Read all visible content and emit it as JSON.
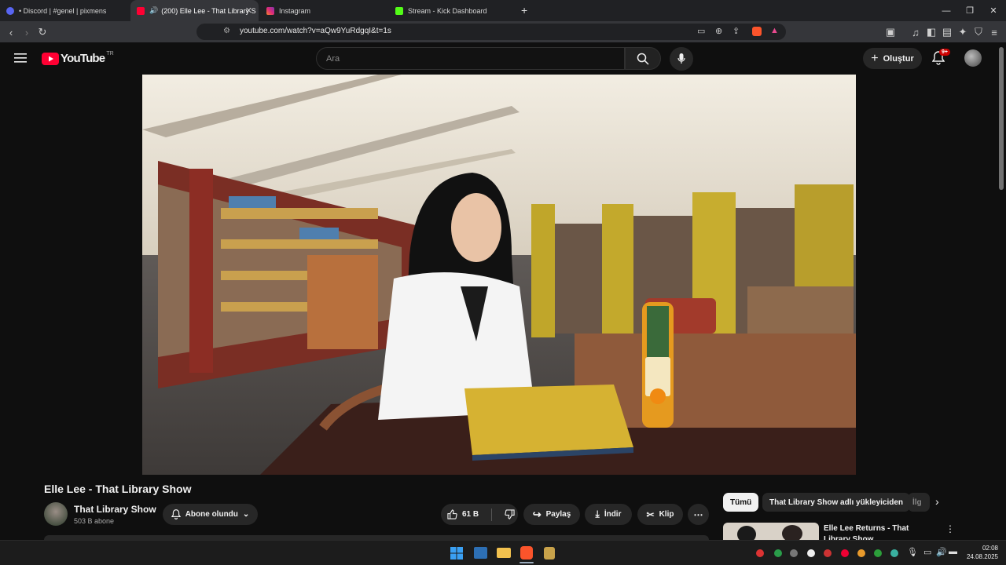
{
  "browser": {
    "tabs": [
      {
        "label": "• Discord | #genel | pixmens",
        "favicon_color": "#5865f2",
        "active": false
      },
      {
        "label": "(200) Elle Lee - That Library S",
        "favicon_color": "#ff0033",
        "active": true
      },
      {
        "label": "Instagram",
        "favicon_color": "#e1306c",
        "active": false
      },
      {
        "label": "Stream - Kick Dashboard",
        "favicon_color": "#53fc18",
        "active": false
      }
    ],
    "url": "youtube.com/watch?v=aQw9YuRdgqI&t=1s"
  },
  "youtube": {
    "logo_text": "YouTube",
    "region": "TR",
    "search_placeholder": "Ara",
    "create_label": "Oluştur",
    "notification_count": "9+",
    "video_title": "Elle Lee - That Library Show",
    "channel_name": "That Library Show",
    "subscriber_count": "503 B abone",
    "subscribe_label": "Abone olundu",
    "like_count": "61 B",
    "share_label": "Paylaş",
    "download_label": "İndir",
    "clip_label": "Klip",
    "chips": [
      "Tümü",
      "That Library Show adlı yükleyiciden",
      "İlg"
    ],
    "recommended_title": "Elle Lee Returns - That Library Show"
  },
  "taskbar": {
    "time": "02:08",
    "date": "24.08.2025"
  },
  "colors": {
    "accent": "#ff0033",
    "background": "#0f0f0f"
  }
}
